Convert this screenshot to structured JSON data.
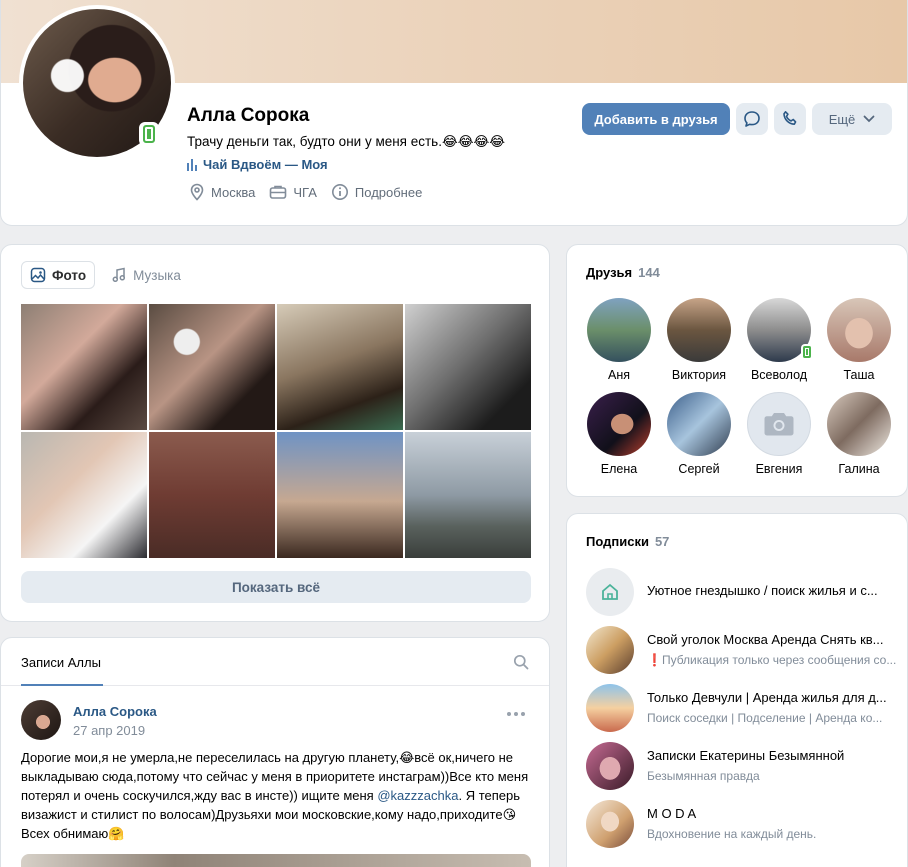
{
  "profile": {
    "name": "Алла Сорока",
    "status": "Трачу деньги так, будто они у меня есть.😂😂😂😂",
    "music": "Чай Вдвоём — Моя",
    "city": "Москва",
    "education": "ЧГА",
    "more_info": "Подробнее",
    "add_friend_label": "Добавить в друзья",
    "more_label": "Ещё"
  },
  "photos": {
    "tab_photo": "Фото",
    "tab_music": "Музыка",
    "show_all": "Показать всё"
  },
  "wall": {
    "tab_label": "Записи Аллы",
    "post": {
      "author": "Алла Сорока",
      "date": "27 апр 2019",
      "text_part1": "Дорогие мои,я не умерла,не переселилась на другую планету,😂всё ок,ничего не выкладываю сюда,потому что сейчас у меня в приоритете инстаграм))Все кто меня потерял и очень соскучился,жду вас в инсте)) ищите меня ",
      "mention": "@kazzzachka",
      "text_part2": ". Я теперь визажист и стилист по волосам)Друзьяхи мои московские,кому надо,приходите😘Всех обнимаю🤗"
    }
  },
  "friends": {
    "title": "Друзья",
    "count": "144",
    "items": [
      {
        "name": "Аня"
      },
      {
        "name": "Виктория"
      },
      {
        "name": "Всеволод"
      },
      {
        "name": "Таша"
      },
      {
        "name": "Елена"
      },
      {
        "name": "Сергей"
      },
      {
        "name": "Евгения"
      },
      {
        "name": "Галина"
      }
    ]
  },
  "subscriptions": {
    "title": "Подписки",
    "count": "57",
    "items": [
      {
        "name": "Уютное гнездышко / поиск жилья и с...",
        "desc": ""
      },
      {
        "name": "Свой уголок Москва Аренда Снять кв...",
        "desc": "❗Публикация только через сообщения со..."
      },
      {
        "name": "Только Девчули | Аренда жилья для д...",
        "desc": "Поиск соседки | Подселение | Аренда ко..."
      },
      {
        "name": "Записки Екатерины Безымянной",
        "desc": "Безымянная правда"
      },
      {
        "name": "M O D A",
        "desc": "Вдохновение на каждый день."
      }
    ]
  },
  "colors": {
    "accent": "#5181b8",
    "link": "#2a5885",
    "online": "#4bb34b",
    "background": "#edeef0"
  }
}
